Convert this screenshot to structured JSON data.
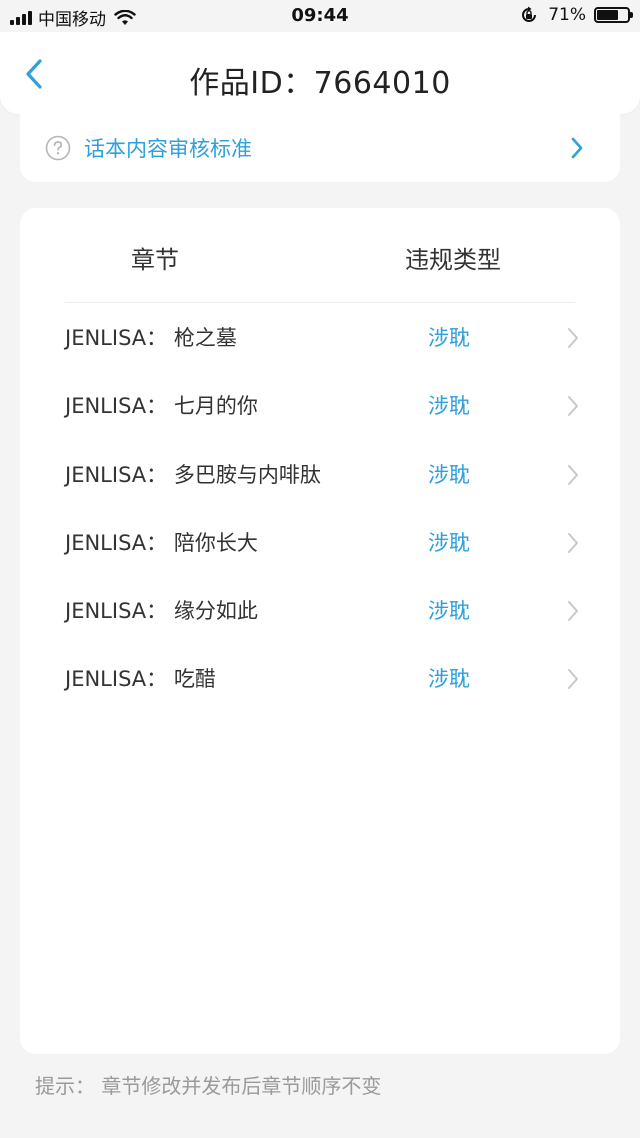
{
  "status_bar": {
    "carrier": "中国移动",
    "time": "09:44",
    "battery_percent": "71%",
    "battery_level": 0.71
  },
  "header": {
    "title": "作品ID：7664010"
  },
  "standards": {
    "label": "话本内容审核标准"
  },
  "table": {
    "col_chapter": "章节",
    "col_type": "违规类型",
    "rows": [
      {
        "title": "JENLISA： 枪之墓",
        "type": "涉耽"
      },
      {
        "title": "JENLISA： 七月的你",
        "type": "涉耽"
      },
      {
        "title": "JENLISA： 多巴胺与内啡肽",
        "type": "涉耽"
      },
      {
        "title": "JENLISA： 陪你长大",
        "type": "涉耽"
      },
      {
        "title": "JENLISA： 缘分如此",
        "type": "涉耽"
      },
      {
        "title": "JENLISA： 吃醋",
        "type": "涉耽"
      }
    ]
  },
  "footer": {
    "hint": "提示： 章节修改并发布后章节顺序不变"
  },
  "colors": {
    "accent": "#2ea0dc",
    "background": "#f4f4f4",
    "card": "#ffffff",
    "chevron_gray": "#c8c8c8"
  }
}
